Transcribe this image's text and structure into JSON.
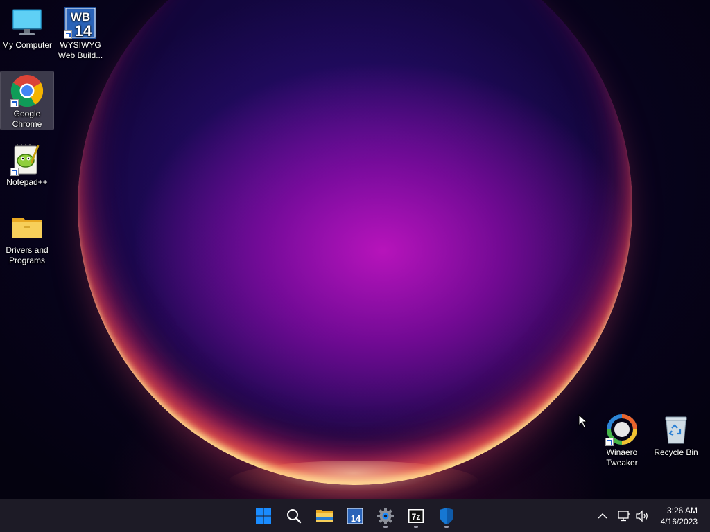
{
  "desktop": {
    "icons": [
      {
        "id": "my-computer",
        "label": "My Computer"
      },
      {
        "id": "wysiwyg",
        "label": "WYSIWYG Web Build..."
      },
      {
        "id": "chrome",
        "label": "Google Chrome"
      },
      {
        "id": "notepadpp",
        "label": "Notepad++"
      },
      {
        "id": "drivers",
        "label": "Drivers and Programs"
      },
      {
        "id": "winaero",
        "label": "Winaero Tweaker"
      },
      {
        "id": "recycle-bin",
        "label": "Recycle Bin"
      }
    ],
    "wb_badge_text": "WB",
    "wb_badge_number": "14"
  },
  "taskbar": {
    "apps": [
      {
        "id": "start",
        "icon": "windows-logo-icon"
      },
      {
        "id": "search",
        "icon": "search-icon"
      },
      {
        "id": "file-explorer",
        "icon": "folder-icon"
      },
      {
        "id": "wysiwyg",
        "icon": "wb14-icon",
        "text": "14"
      },
      {
        "id": "settings",
        "icon": "gear-icon",
        "running": true
      },
      {
        "id": "7zip",
        "icon": "7zip-icon",
        "text": "7z",
        "running": true
      },
      {
        "id": "defender",
        "icon": "shield-icon",
        "running": true
      }
    ],
    "tray": {
      "overflow_icon": "chevron-up-icon",
      "network_icon": "network-icon",
      "volume_icon": "volume-icon"
    },
    "clock": {
      "time": "3:26 AM",
      "date": "4/16/2023"
    }
  },
  "colors": {
    "taskbar_bg": "#1d1b26",
    "accent_blue": "#1a8cff",
    "folder_yellow": "#f5c842"
  }
}
